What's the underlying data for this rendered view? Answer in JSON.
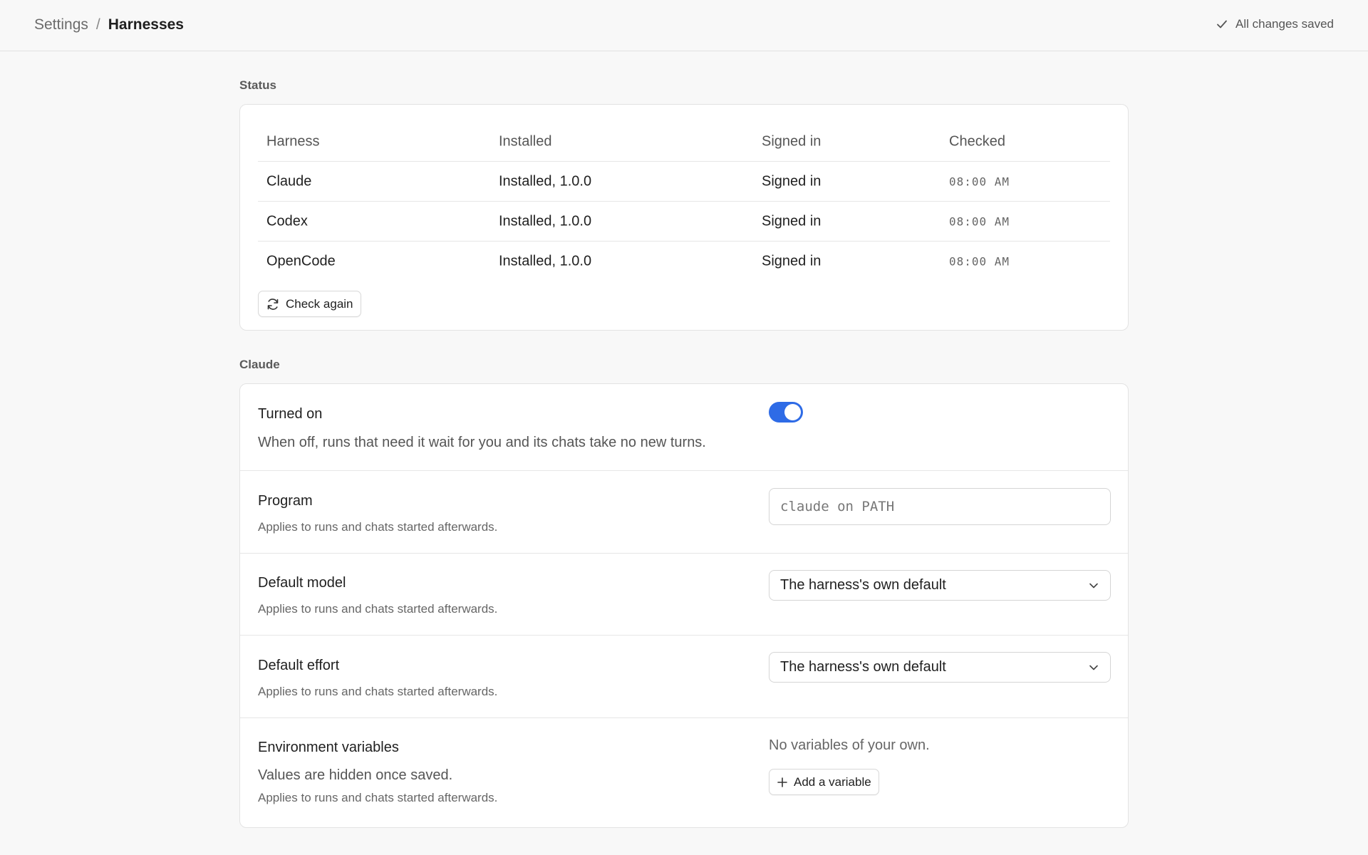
{
  "breadcrumb": {
    "root": "Settings",
    "separator": "/",
    "current": "Harnesses"
  },
  "save_status": {
    "text": "All changes saved",
    "icon": "check-icon"
  },
  "status_section": {
    "label": "Status",
    "columns": [
      "Harness",
      "Installed",
      "Signed in",
      "Checked"
    ],
    "rows": [
      {
        "harness": "Claude",
        "installed": "Installed, 1.0.0",
        "signed_in": "Signed in",
        "checked": "08:00 AM"
      },
      {
        "harness": "Codex",
        "installed": "Installed, 1.0.0",
        "signed_in": "Signed in",
        "checked": "08:00 AM"
      },
      {
        "harness": "OpenCode",
        "installed": "Installed, 1.0.0",
        "signed_in": "Signed in",
        "checked": "08:00 AM"
      }
    ],
    "check_again_label": "Check again"
  },
  "claude_section": {
    "label": "Claude",
    "turned_on": {
      "title": "Turned on",
      "description": "When off, runs that need it wait for you and its chats take no new turns.",
      "enabled": true
    },
    "program": {
      "title": "Program",
      "description": "Applies to runs and chats started afterwards.",
      "placeholder": "claude on PATH"
    },
    "default_model": {
      "title": "Default model",
      "description": "Applies to runs and chats started afterwards.",
      "selected": "The harness's own default"
    },
    "default_effort": {
      "title": "Default effort",
      "description": "Applies to runs and chats started afterwards.",
      "selected": "The harness's own default"
    },
    "env_vars": {
      "title": "Environment variables",
      "note": "Values are hidden once saved.",
      "description": "Applies to runs and chats started afterwards.",
      "empty_text": "No variables of your own.",
      "add_label": "Add a variable"
    }
  },
  "colors": {
    "accent": "#2e6be6",
    "background": "#f8f8f8",
    "card": "#ffffff"
  }
}
